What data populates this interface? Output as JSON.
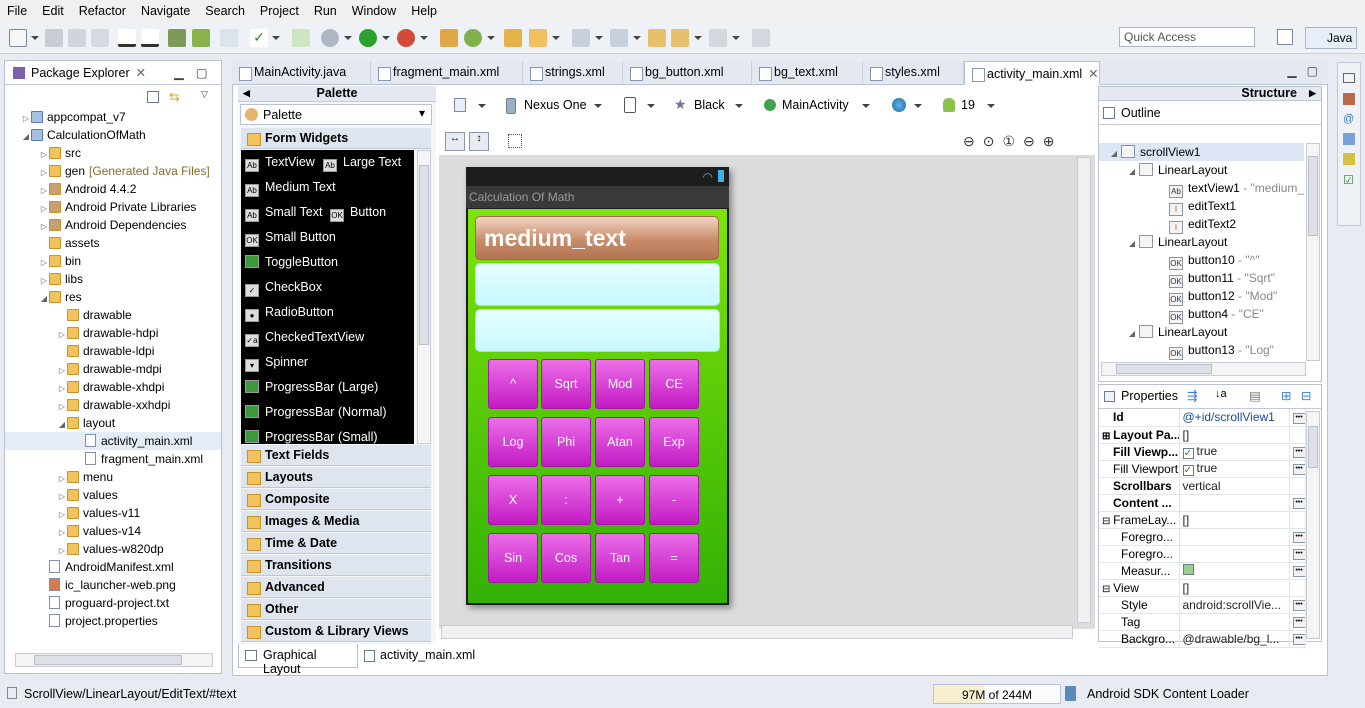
{
  "menu": [
    "File",
    "Edit",
    "Refactor",
    "Navigate",
    "Search",
    "Project",
    "Run",
    "Window",
    "Help"
  ],
  "toolbar": {
    "quick_access_placeholder": "Quick Access",
    "perspective": "Java"
  },
  "package_explorer": {
    "title": "Package Explorer",
    "items": [
      {
        "label": "appcompat_v7",
        "extra": ""
      },
      {
        "label": "CalculationOfMath",
        "extra": ""
      },
      {
        "label": "src",
        "extra": ""
      },
      {
        "label": "gen",
        "extra": "[Generated Java Files]"
      },
      {
        "label": "Android 4.4.2",
        "extra": ""
      },
      {
        "label": "Android Private Libraries",
        "extra": ""
      },
      {
        "label": "Android Dependencies",
        "extra": ""
      },
      {
        "label": "assets",
        "extra": ""
      },
      {
        "label": "bin",
        "extra": ""
      },
      {
        "label": "libs",
        "extra": ""
      },
      {
        "label": "res",
        "extra": ""
      },
      {
        "label": "drawable",
        "extra": ""
      },
      {
        "label": "drawable-hdpi",
        "extra": ""
      },
      {
        "label": "drawable-ldpi",
        "extra": ""
      },
      {
        "label": "drawable-mdpi",
        "extra": ""
      },
      {
        "label": "drawable-xhdpi",
        "extra": ""
      },
      {
        "label": "drawable-xxhdpi",
        "extra": ""
      },
      {
        "label": "layout",
        "extra": ""
      },
      {
        "label": "activity_main.xml",
        "extra": ""
      },
      {
        "label": "fragment_main.xml",
        "extra": ""
      },
      {
        "label": "menu",
        "extra": ""
      },
      {
        "label": "values",
        "extra": ""
      },
      {
        "label": "values-v11",
        "extra": ""
      },
      {
        "label": "values-v14",
        "extra": ""
      },
      {
        "label": "values-w820dp",
        "extra": ""
      },
      {
        "label": "AndroidManifest.xml",
        "extra": ""
      },
      {
        "label": "ic_launcher-web.png",
        "extra": ""
      },
      {
        "label": "proguard-project.txt",
        "extra": ""
      },
      {
        "label": "project.properties",
        "extra": ""
      }
    ]
  },
  "editor_tabs": [
    "MainActivity.java",
    "fragment_main.xml",
    "strings.xml",
    "bg_button.xml",
    "bg_text.xml",
    "styles.xml",
    "activity_main.xml"
  ],
  "palette": {
    "title": "Palette",
    "selector": "Palette",
    "open_category": "Form Widgets",
    "widgets": [
      {
        "label": "TextView",
        "icon": "Ab"
      },
      {
        "label": "Large Text",
        "icon": "Ab"
      },
      {
        "label": "Medium Text",
        "icon": "Ab"
      },
      {
        "label": "Small Text",
        "icon": "Ab"
      },
      {
        "label": "Button",
        "icon": "OK"
      },
      {
        "label": "Small Button",
        "icon": "OK"
      },
      {
        "label": "ToggleButton",
        "icon": ""
      },
      {
        "label": "CheckBox",
        "icon": "✓"
      },
      {
        "label": "RadioButton",
        "icon": "●"
      },
      {
        "label": "CheckedTextView",
        "icon": "✓a"
      },
      {
        "label": "Spinner",
        "icon": "▾"
      },
      {
        "label": "ProgressBar (Large)",
        "icon": ""
      },
      {
        "label": "ProgressBar (Normal)",
        "icon": ""
      },
      {
        "label": "ProgressBar (Small)",
        "icon": ""
      }
    ],
    "categories": [
      "Text Fields",
      "Layouts",
      "Composite",
      "Images & Media",
      "Time & Date",
      "Transitions",
      "Advanced",
      "Other",
      "Custom & Library Views"
    ]
  },
  "config_bar": {
    "device": "Nexus One",
    "theme": "Black",
    "activity": "MainActivity",
    "api": "19"
  },
  "app": {
    "title_bar": "Calculation Of Math",
    "display": "medium_text",
    "keys": [
      "^",
      "Sqrt",
      "Mod",
      "CE",
      "Log",
      "Phi",
      "Atan",
      "Exp",
      "X",
      ":",
      "+",
      "-",
      "Sin",
      "Cos",
      "Tan",
      "="
    ]
  },
  "structure": {
    "title": "Structure",
    "outline_title": "Outline",
    "nodes": [
      {
        "label": "scrollView1",
        "detail": ""
      },
      {
        "label": "LinearLayout",
        "detail": ""
      },
      {
        "label": "textView1",
        "detail": " - \"medium_t"
      },
      {
        "label": "editText1",
        "detail": ""
      },
      {
        "label": "editText2",
        "detail": ""
      },
      {
        "label": "LinearLayout",
        "detail": ""
      },
      {
        "label": "button10",
        "detail": " - \"^\""
      },
      {
        "label": "button11",
        "detail": " - \"Sqrt\""
      },
      {
        "label": "button12",
        "detail": " - \"Mod\""
      },
      {
        "label": "button4",
        "detail": " - \"CE\""
      },
      {
        "label": "LinearLayout",
        "detail": ""
      },
      {
        "label": "button13",
        "detail": " - \"Log\""
      }
    ]
  },
  "properties": {
    "title": "Properties",
    "rows": [
      {
        "name": "Id",
        "value": "@+id/scrollView1"
      },
      {
        "name": "Layout Pa...",
        "value": "[]"
      },
      {
        "name": "Fill Viewp...",
        "value": "true"
      },
      {
        "name": "Fill Viewport",
        "value": "true"
      },
      {
        "name": "Scrollbars",
        "value": "vertical"
      },
      {
        "name": "Content ...",
        "value": ""
      },
      {
        "name": "FrameLay...",
        "value": "[]"
      },
      {
        "name": "Foregro...",
        "value": ""
      },
      {
        "name": "Foregro...",
        "value": ""
      },
      {
        "name": "Measur...",
        "value": ""
      },
      {
        "name": "View",
        "value": "[]"
      },
      {
        "name": "Style",
        "value": "android:scrollVie..."
      },
      {
        "name": "Tag",
        "value": ""
      },
      {
        "name": "Backgro...",
        "value": "@drawable/bg_l..."
      }
    ]
  },
  "bottom_tabs": [
    "Graphical Layout",
    "activity_main.xml"
  ],
  "status": {
    "path": "ScrollView/LinearLayout/EditText/#text",
    "memory": "97M of 244M",
    "task": "Android SDK Content Loader"
  },
  "colors": {
    "accent": "#3a7bd5",
    "phone_bg": "#33b106",
    "key": "#d53cd4",
    "title_bar": "#b27352",
    "edit_bg": "#d6fbff"
  }
}
